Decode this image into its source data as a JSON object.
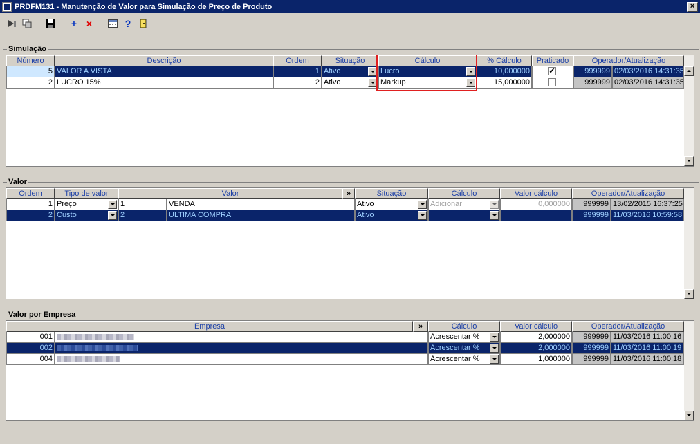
{
  "window": {
    "title": "PRDFM131 - Manutenção de Valor para Simulação de Preço de Produto",
    "close": "×"
  },
  "toolbar": {
    "add": "+",
    "delete": "×",
    "help": "?"
  },
  "simulacao": {
    "title": "Simulação",
    "headers": [
      "Número",
      "Descrição",
      "Ordem",
      "Situação",
      "Cálculo",
      "% Cálculo",
      "Praticado",
      "Operador/Atualização"
    ],
    "rows": [
      {
        "numero": "5",
        "descricao": "VALOR A VISTA",
        "ordem": "1",
        "situacao": "Ativo",
        "calculo": "Lucro",
        "pct": "10,000000",
        "praticado": "✔",
        "operador": "999999",
        "data": "02/03/2016 14:31:35"
      },
      {
        "numero": "2",
        "descricao": "LUCRO 15%",
        "ordem": "2",
        "situacao": "Ativo",
        "calculo": "Markup",
        "pct": "15,000000",
        "praticado": "",
        "operador": "999999",
        "data": "02/03/2016 14:31:35"
      }
    ]
  },
  "valor": {
    "title": "Valor",
    "headers": [
      "Ordem",
      "Tipo de valor",
      "Valor",
      "»",
      "Situação",
      "Cálculo",
      "Valor cálculo",
      "Operador/Atualização"
    ],
    "rows": [
      {
        "ordem": "1",
        "tipo": "Preço",
        "cod": "1",
        "valor": "VENDA",
        "situacao": "Ativo",
        "calculo": "Adicionar",
        "vcalc": "0,000000",
        "operador": "999999",
        "data": "13/02/2015 16:37:25"
      },
      {
        "ordem": "2",
        "tipo": "Custo",
        "cod": "2",
        "valor": "ULTIMA COMPRA",
        "situacao": "Ativo",
        "calculo": "",
        "vcalc": "",
        "operador": "999999",
        "data": "11/03/2016 10:59:58"
      }
    ]
  },
  "empresa": {
    "title": "Valor por Empresa",
    "headers": [
      "Empresa",
      "»",
      "Cálculo",
      "Valor cálculo",
      "Operador/Atualização"
    ],
    "rows": [
      {
        "codigo": "001",
        "calculo": "Acrescentar %",
        "vcalc": "2,000000",
        "operador": "999999",
        "data": "11/03/2016 11:00:16"
      },
      {
        "codigo": "002",
        "calculo": "Acrescentar %",
        "vcalc": "2,000000",
        "operador": "999999",
        "data": "11/03/2016 11:00:19"
      },
      {
        "codigo": "004",
        "calculo": "Acrescentar %",
        "vcalc": "1,000000",
        "operador": "999999",
        "data": "11/03/2016 11:00:18"
      }
    ]
  },
  "colors": {
    "selection": "#0a246a",
    "highlight_box": "#e02020",
    "header_text": "#1a3ea6"
  }
}
